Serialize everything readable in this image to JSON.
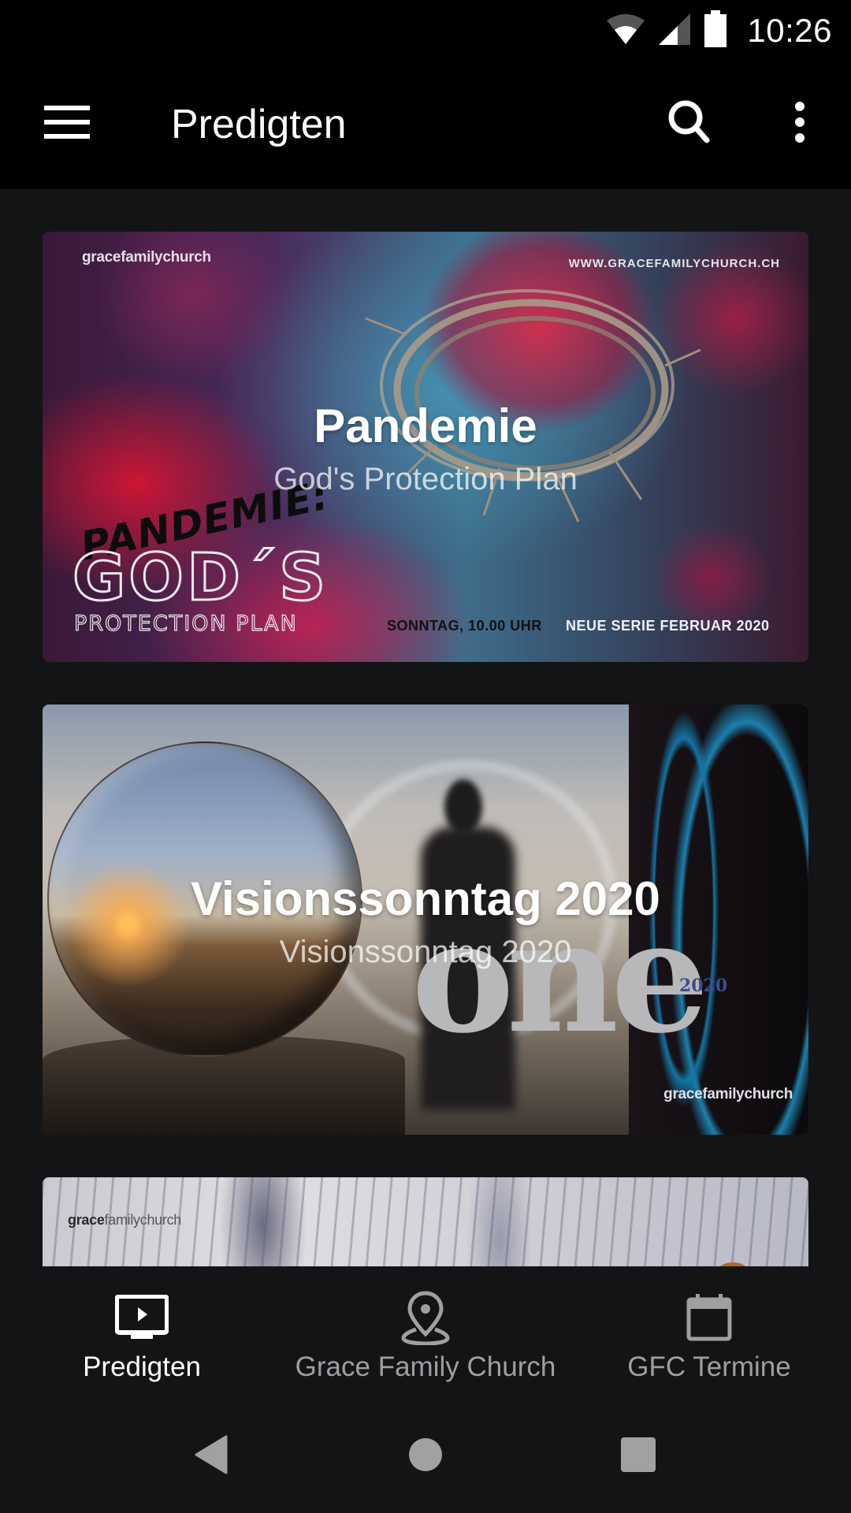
{
  "status_bar": {
    "time": "10:26",
    "icons": [
      "wifi-icon",
      "cell-signal-icon",
      "battery-icon"
    ]
  },
  "app_bar": {
    "title": "Predigten",
    "menu_icon": "hamburger-menu-icon",
    "search_icon": "search-icon",
    "more_icon": "more-vert-icon"
  },
  "sermons": [
    {
      "title": "Pandemie",
      "subtitle": "God's Protection Plan",
      "artwork": {
        "logo": "gracefamilychurch",
        "url": "WWW.GRACEFAMILYCHURCH.CH",
        "headline_script": "PANDEMIE:",
        "headline_main": "GOD´S",
        "headline_sub": "PROTECTION PLAN",
        "time_text": "SONNTAG, 10.00 UHR",
        "series_text": "NEUE SERIE FEBRUAR 2020"
      }
    },
    {
      "title": "Visionssonntag 2020",
      "subtitle": "Visionssonntag 2020",
      "artwork": {
        "big_word": "one",
        "year": "2020",
        "logo": "gracefamilychurch"
      }
    },
    {
      "title": "",
      "subtitle": "",
      "artwork": {
        "logo_bold": "grace",
        "logo_light": "familychurch"
      }
    }
  ],
  "bottom_nav": {
    "items": [
      {
        "label": "Predigten",
        "icon": "video-play-icon",
        "active": true
      },
      {
        "label": "Grace Family Church",
        "icon": "location-pin-icon",
        "active": false
      },
      {
        "label": "GFC Termine",
        "icon": "calendar-icon",
        "active": false
      }
    ]
  },
  "system_nav": {
    "buttons": [
      "back-icon",
      "home-icon",
      "recents-icon"
    ]
  },
  "colors": {
    "app_bar_bg": "#000000",
    "page_bg": "#131416",
    "nav_active": "#ffffff",
    "nav_inactive": "#9e9fa1",
    "system_icon": "#a0a1a2"
  }
}
